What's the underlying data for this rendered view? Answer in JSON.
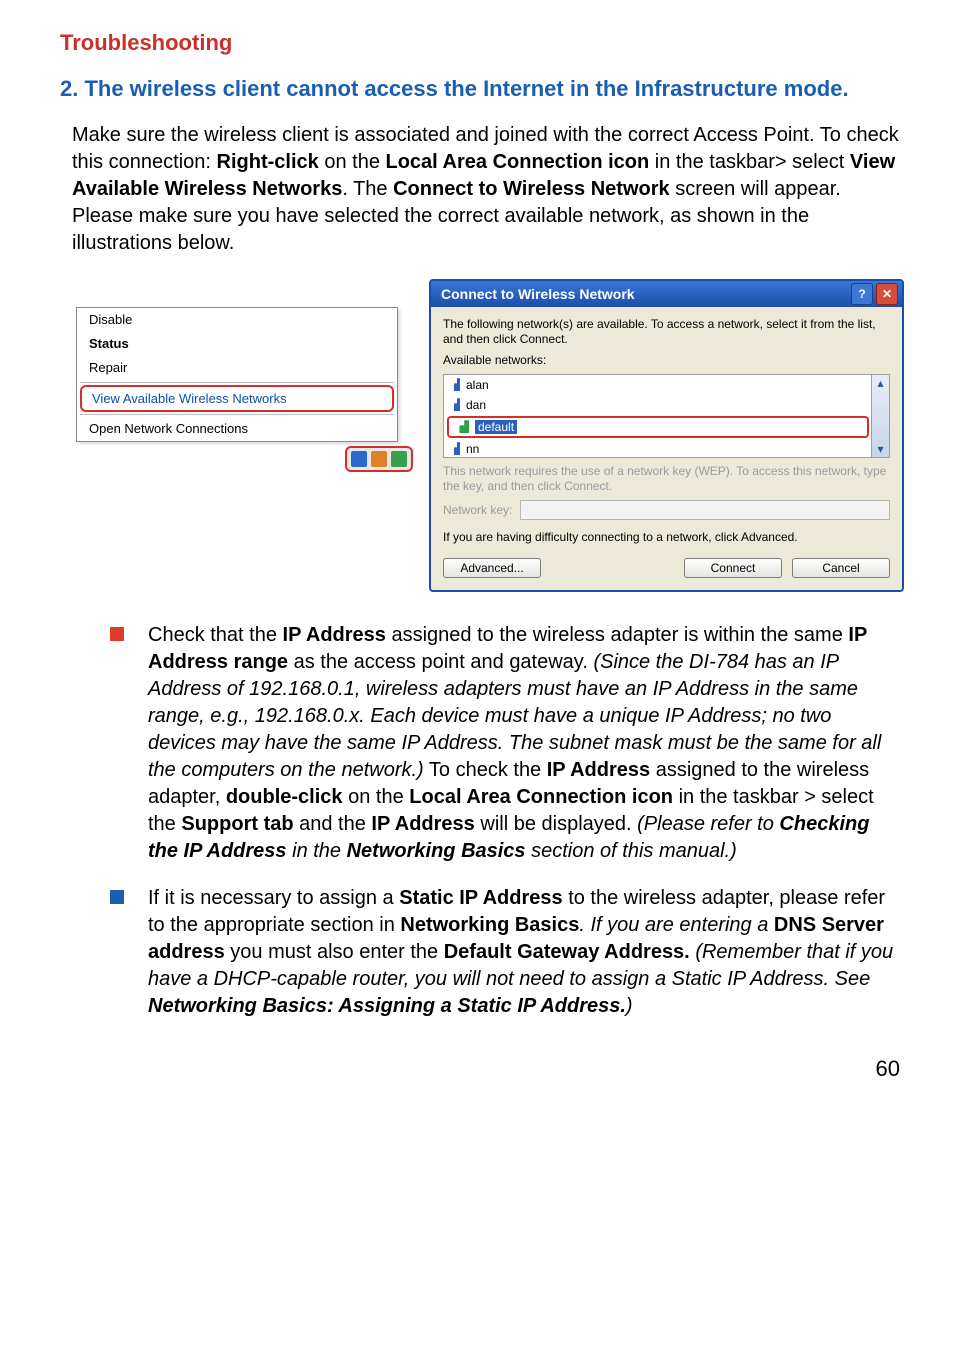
{
  "section_title": "Troubleshooting",
  "subtitle": "2. The wireless client cannot access the Internet in the Infrastructure mode.",
  "intro": {
    "p1a": "Make sure the wireless client is associated and joined with the correct Access Point.  To check this connection: ",
    "b1": "Right-click",
    "p1b": " on the ",
    "b2": "Local Area Connection icon",
    "p1c": " in the taskbar> select ",
    "b3": "View Available Wireless Networks",
    "p1d": ". The ",
    "b4": "Connect to Wireless Network",
    "p1e": " screen will appear. Please make sure you have selected the correct available network, as shown in the illustrations below."
  },
  "ctx": {
    "disable": "Disable",
    "status": "Status",
    "repair": "Repair",
    "view": "View Available Wireless Networks",
    "open": "Open Network Connections"
  },
  "dlg": {
    "title": "Connect to Wireless Network",
    "desc": "The following network(s) are available. To access a network, select it from the list, and then click Connect.",
    "avail": "Available networks:",
    "nets": {
      "n0": "alan",
      "n1": "dan",
      "n2": "default",
      "n3": "nn"
    },
    "wep": "This network requires the use of a network key (WEP). To access this network, type the key, and then click Connect.",
    "keylab": "Network key:",
    "diff": "If you are having difficulty connecting to a network, click Advanced.",
    "advanced": "Advanced...",
    "connect": "Connect",
    "cancel": "Cancel"
  },
  "bul1": {
    "a": "Check that the ",
    "b1": "IP Address",
    "c": " assigned to the wireless adapter is within the same ",
    "b2": "IP Address range",
    "d": " as the access point and gateway. ",
    "i1": "(Since the DI-784 has an IP Address of 192.168.0.1, wireless adapters must have an IP Address in the same range, e.g., 192.168.0.x. Each device must have a unique IP Address; no two devices may have the same IP Address. The subnet mask must be the same for all the computers on the network.)",
    "e": " To check the ",
    "b3": "IP Address",
    "f": " assigned to the wireless adapter, ",
    "b4": "double-click",
    "g": " on the ",
    "b5": "Local Area Connection icon",
    "h": " in the taskbar > select the ",
    "b6": "Support tab",
    "i": " and the ",
    "b7": "IP Address",
    "j": " will be displayed. ",
    "i2a": "(Please refer to ",
    "i2bi": "Checking the IP Address",
    "i2b": " in the ",
    "i2ci": "Networking Basics",
    "i2c": " section of this manual.)"
  },
  "bul2": {
    "a": "If it is necessary to assign a ",
    "b1": "Static IP Address",
    "b": " to the wireless adapter, please refer to the appropriate section in ",
    "b2": "Networking Basics",
    "c": ".  If you are entering a ",
    "b3": "DNS Server address",
    "d": " you must also enter the ",
    "b4": "Default Gateway Address.",
    "e": " ",
    "i1a": "(Remember that if you have a DHCP-capable router, you will not need to assign a Static IP Address. See  ",
    "i1bi": "Networking Basics: Assigning a Static IP Address.",
    "i1b": ")"
  },
  "page_number": "60"
}
